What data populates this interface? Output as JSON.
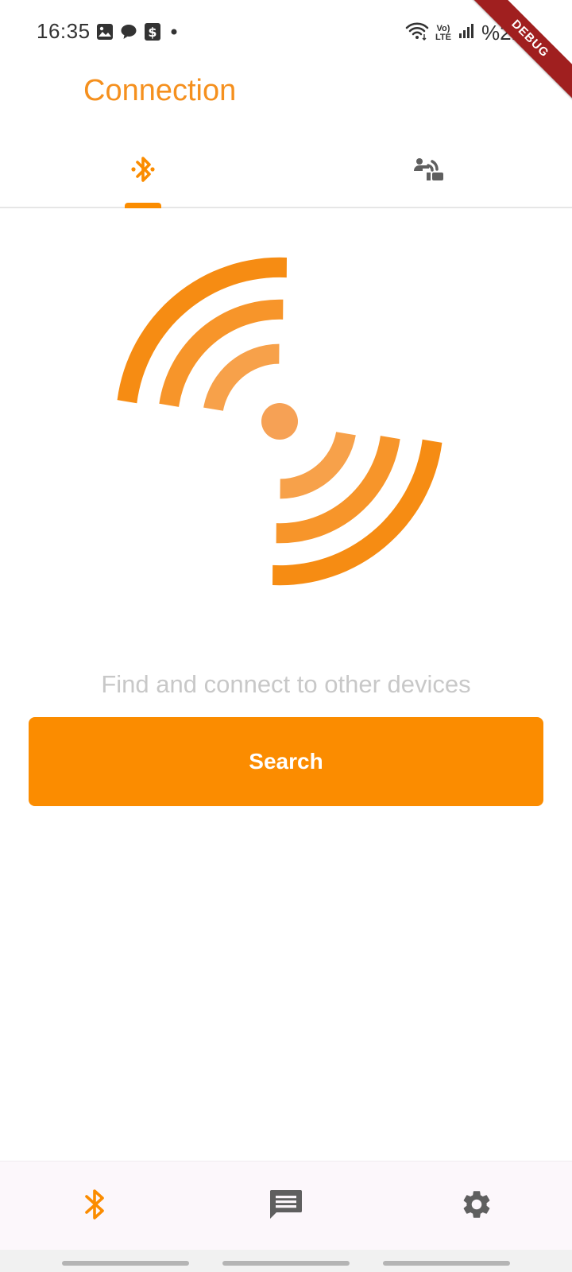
{
  "status_bar": {
    "time": "16:35",
    "left_icons": [
      "gallery-icon",
      "chat-icon",
      "dollar-icon",
      "dot-icon"
    ],
    "right_icons": [
      "wifi-icon",
      "volte-icon",
      "signal-icon"
    ],
    "volte_top": "Vo)",
    "volte_bottom": "LTE",
    "battery": "%21"
  },
  "debug_banner": "DEBUG",
  "app_bar": {
    "title": "Connection"
  },
  "tabs": [
    {
      "icon": "bluetooth-icon",
      "selected": true
    },
    {
      "icon": "nearby-share-icon",
      "selected": false
    }
  ],
  "main": {
    "illustration": "radio-waves-icon",
    "subtitle": "Find and connect to other devices",
    "search_button_label": "Search"
  },
  "bottom_nav": {
    "items": [
      {
        "icon": "bluetooth-icon",
        "selected": true
      },
      {
        "icon": "message-icon",
        "selected": false
      },
      {
        "icon": "settings-gear-icon",
        "selected": false
      }
    ]
  },
  "colors": {
    "accent": "#fb8c00",
    "title": "#f5901e",
    "inactive_icon": "#5f5f5f",
    "subtitle": "#c8c8c8",
    "debug_banner": "#a01f1f"
  }
}
